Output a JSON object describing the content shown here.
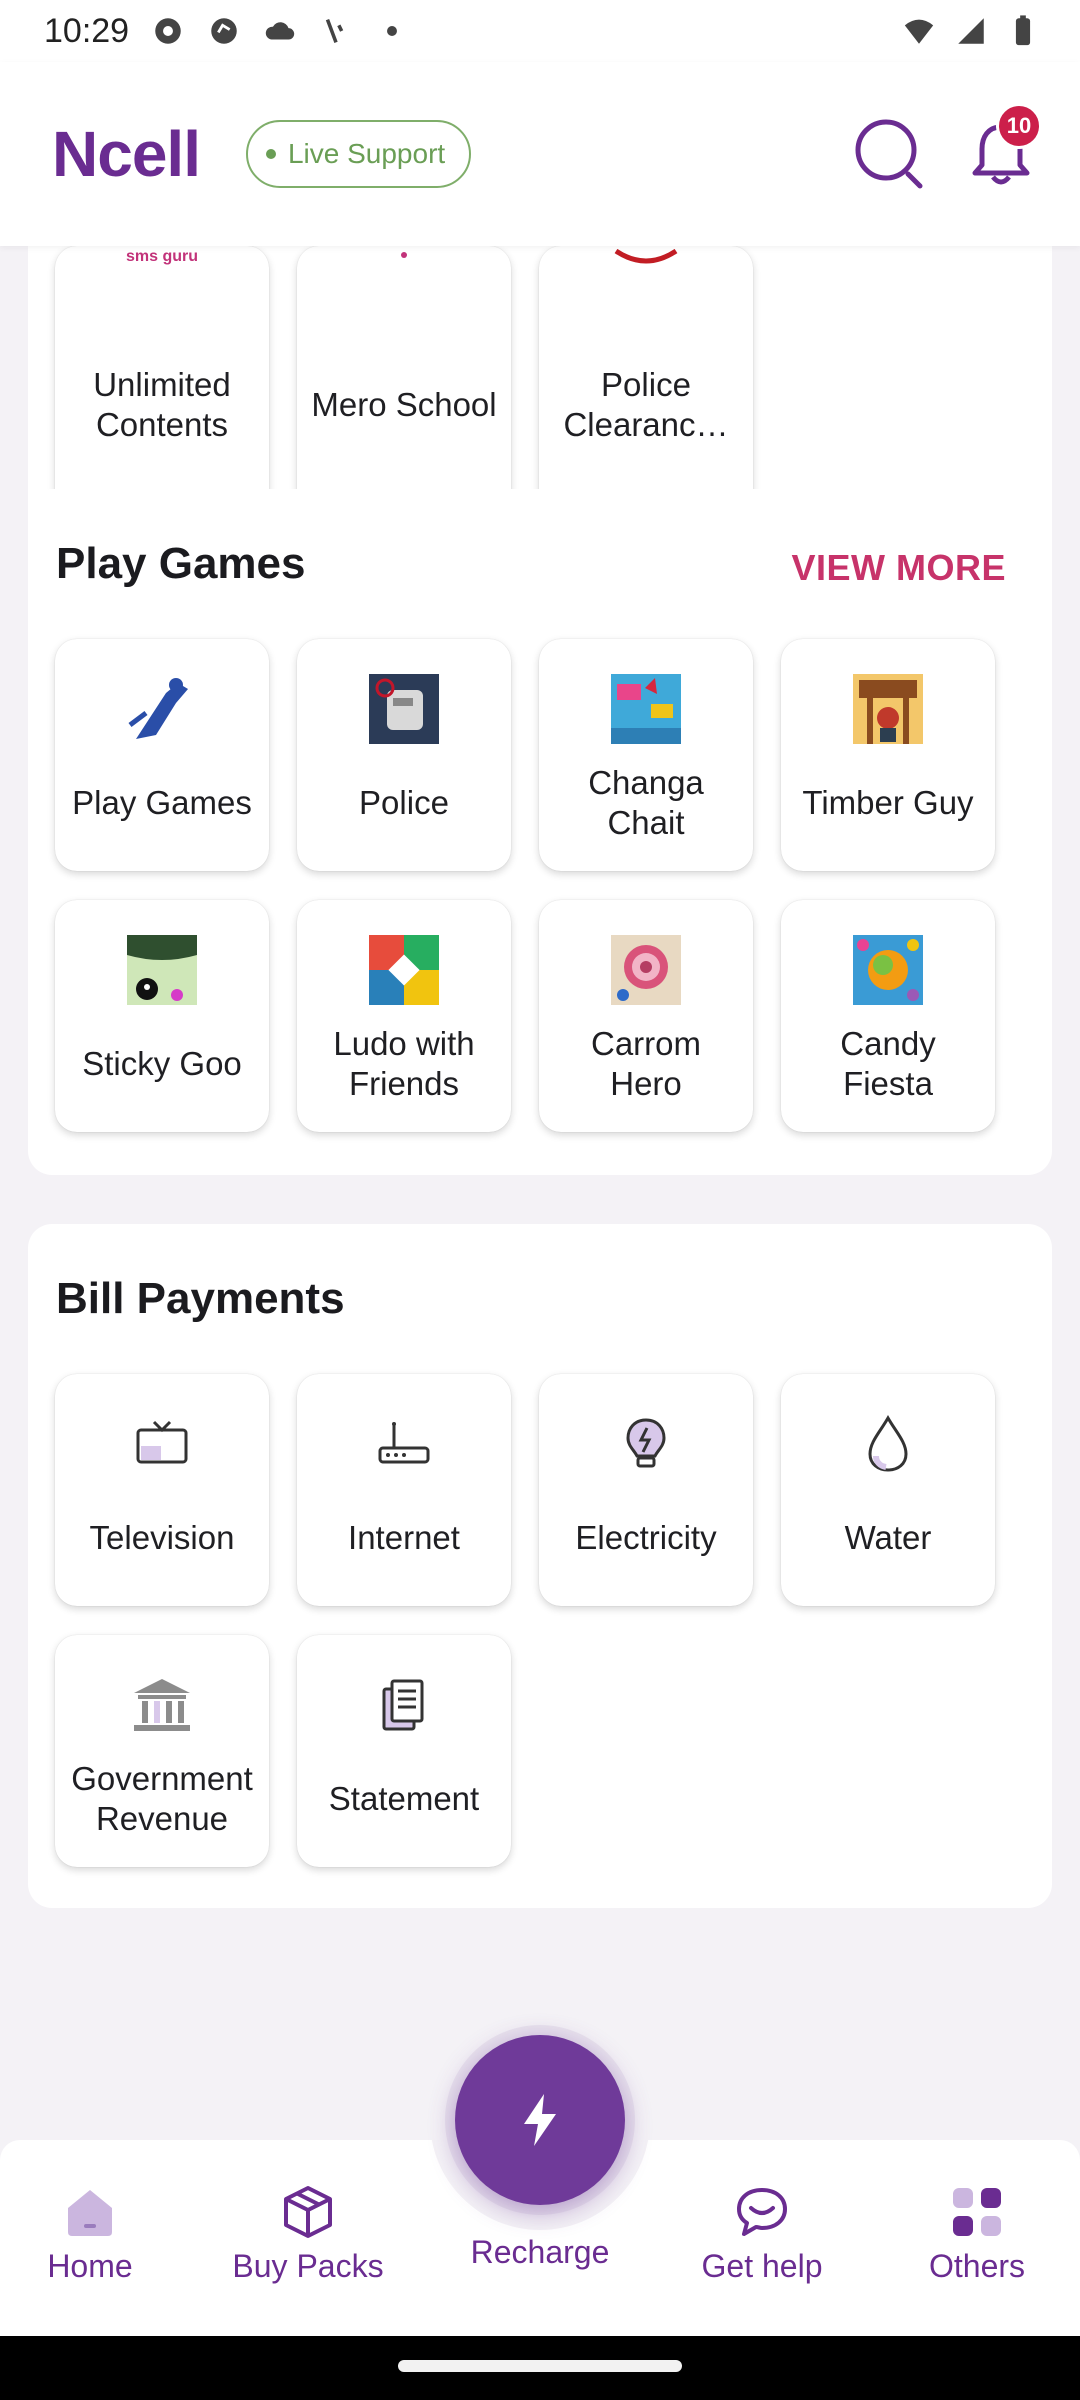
{
  "status_bar": {
    "time": "10:29"
  },
  "header": {
    "logo": "Ncell",
    "live_support": "Live Support",
    "notification_count": "10"
  },
  "top_section": {
    "tiles": [
      {
        "label": "Unlimited Contents",
        "icon_text": "sms guru"
      },
      {
        "label": "Mero School"
      },
      {
        "label": "Police Clearanc…"
      }
    ]
  },
  "games": {
    "title": "Play Games",
    "view_more": "VIEW MORE",
    "tiles": [
      {
        "label": "Play Games",
        "icon": "cricket-icon"
      },
      {
        "label": "Police",
        "icon": "police-game-icon"
      },
      {
        "label": "Changa Chait",
        "icon": "changa-chait-icon"
      },
      {
        "label": "Timber Guy",
        "icon": "timber-guy-icon"
      },
      {
        "label": "Sticky Goo",
        "icon": "sticky-goo-icon"
      },
      {
        "label": "Ludo with Friends",
        "icon": "ludo-icon"
      },
      {
        "label": "Carrom Hero",
        "icon": "carrom-icon"
      },
      {
        "label": "Candy Fiesta",
        "icon": "candy-icon"
      }
    ]
  },
  "bills": {
    "title": "Bill Payments",
    "tiles": [
      {
        "label": "Television",
        "icon": "tv-icon"
      },
      {
        "label": "Internet",
        "icon": "router-icon"
      },
      {
        "label": "Electricity",
        "icon": "bulb-icon"
      },
      {
        "label": "Water",
        "icon": "water-drop-icon"
      },
      {
        "label": "Government Revenue",
        "icon": "government-building-icon"
      },
      {
        "label": "Statement",
        "icon": "statement-icon"
      }
    ]
  },
  "bottom_nav": {
    "home": "Home",
    "buy_packs": "Buy Packs",
    "recharge": "Recharge",
    "get_help": "Get help",
    "others": "Others"
  },
  "colors": {
    "brand_purple": "#6a2c91",
    "accent_pink": "#c7336a",
    "live_green": "#6a9e55",
    "badge_red": "#cc1f4a"
  }
}
